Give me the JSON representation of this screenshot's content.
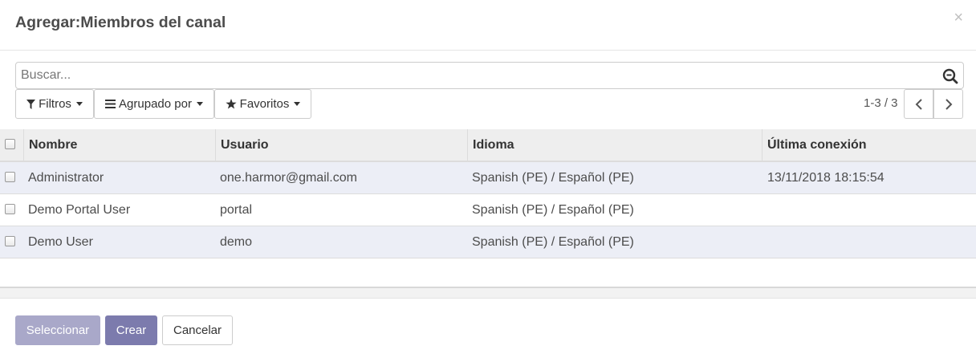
{
  "dialog": {
    "title": "Agregar:Miembros del canal",
    "close_label": "×"
  },
  "search": {
    "placeholder": "Buscar..."
  },
  "toolbar": {
    "filters_label": "Filtros",
    "group_by_label": "Agrupado por",
    "favorites_label": "Favoritos"
  },
  "pager": {
    "value": "1-3 / 3"
  },
  "table": {
    "columns": [
      "Nombre",
      "Usuario",
      "Idioma",
      "Última conexión"
    ],
    "rows": [
      {
        "name": "Administrator",
        "user": "one.harmor@gmail.com",
        "language": "Spanish (PE) / Español (PE)",
        "last_login": "13/11/2018 18:15:54"
      },
      {
        "name": "Demo Portal User",
        "user": "portal",
        "language": "Spanish (PE) / Español (PE)",
        "last_login": ""
      },
      {
        "name": "Demo User",
        "user": "demo",
        "language": "Spanish (PE) / Español (PE)",
        "last_login": ""
      }
    ]
  },
  "footer": {
    "select_label": "Seleccionar",
    "create_label": "Crear",
    "cancel_label": "Cancelar"
  },
  "colors": {
    "primary": "#7c7bad",
    "primary_disabled": "#a9a8c9",
    "row_stripe": "#eceef6",
    "header_bg": "#eeeeee"
  }
}
